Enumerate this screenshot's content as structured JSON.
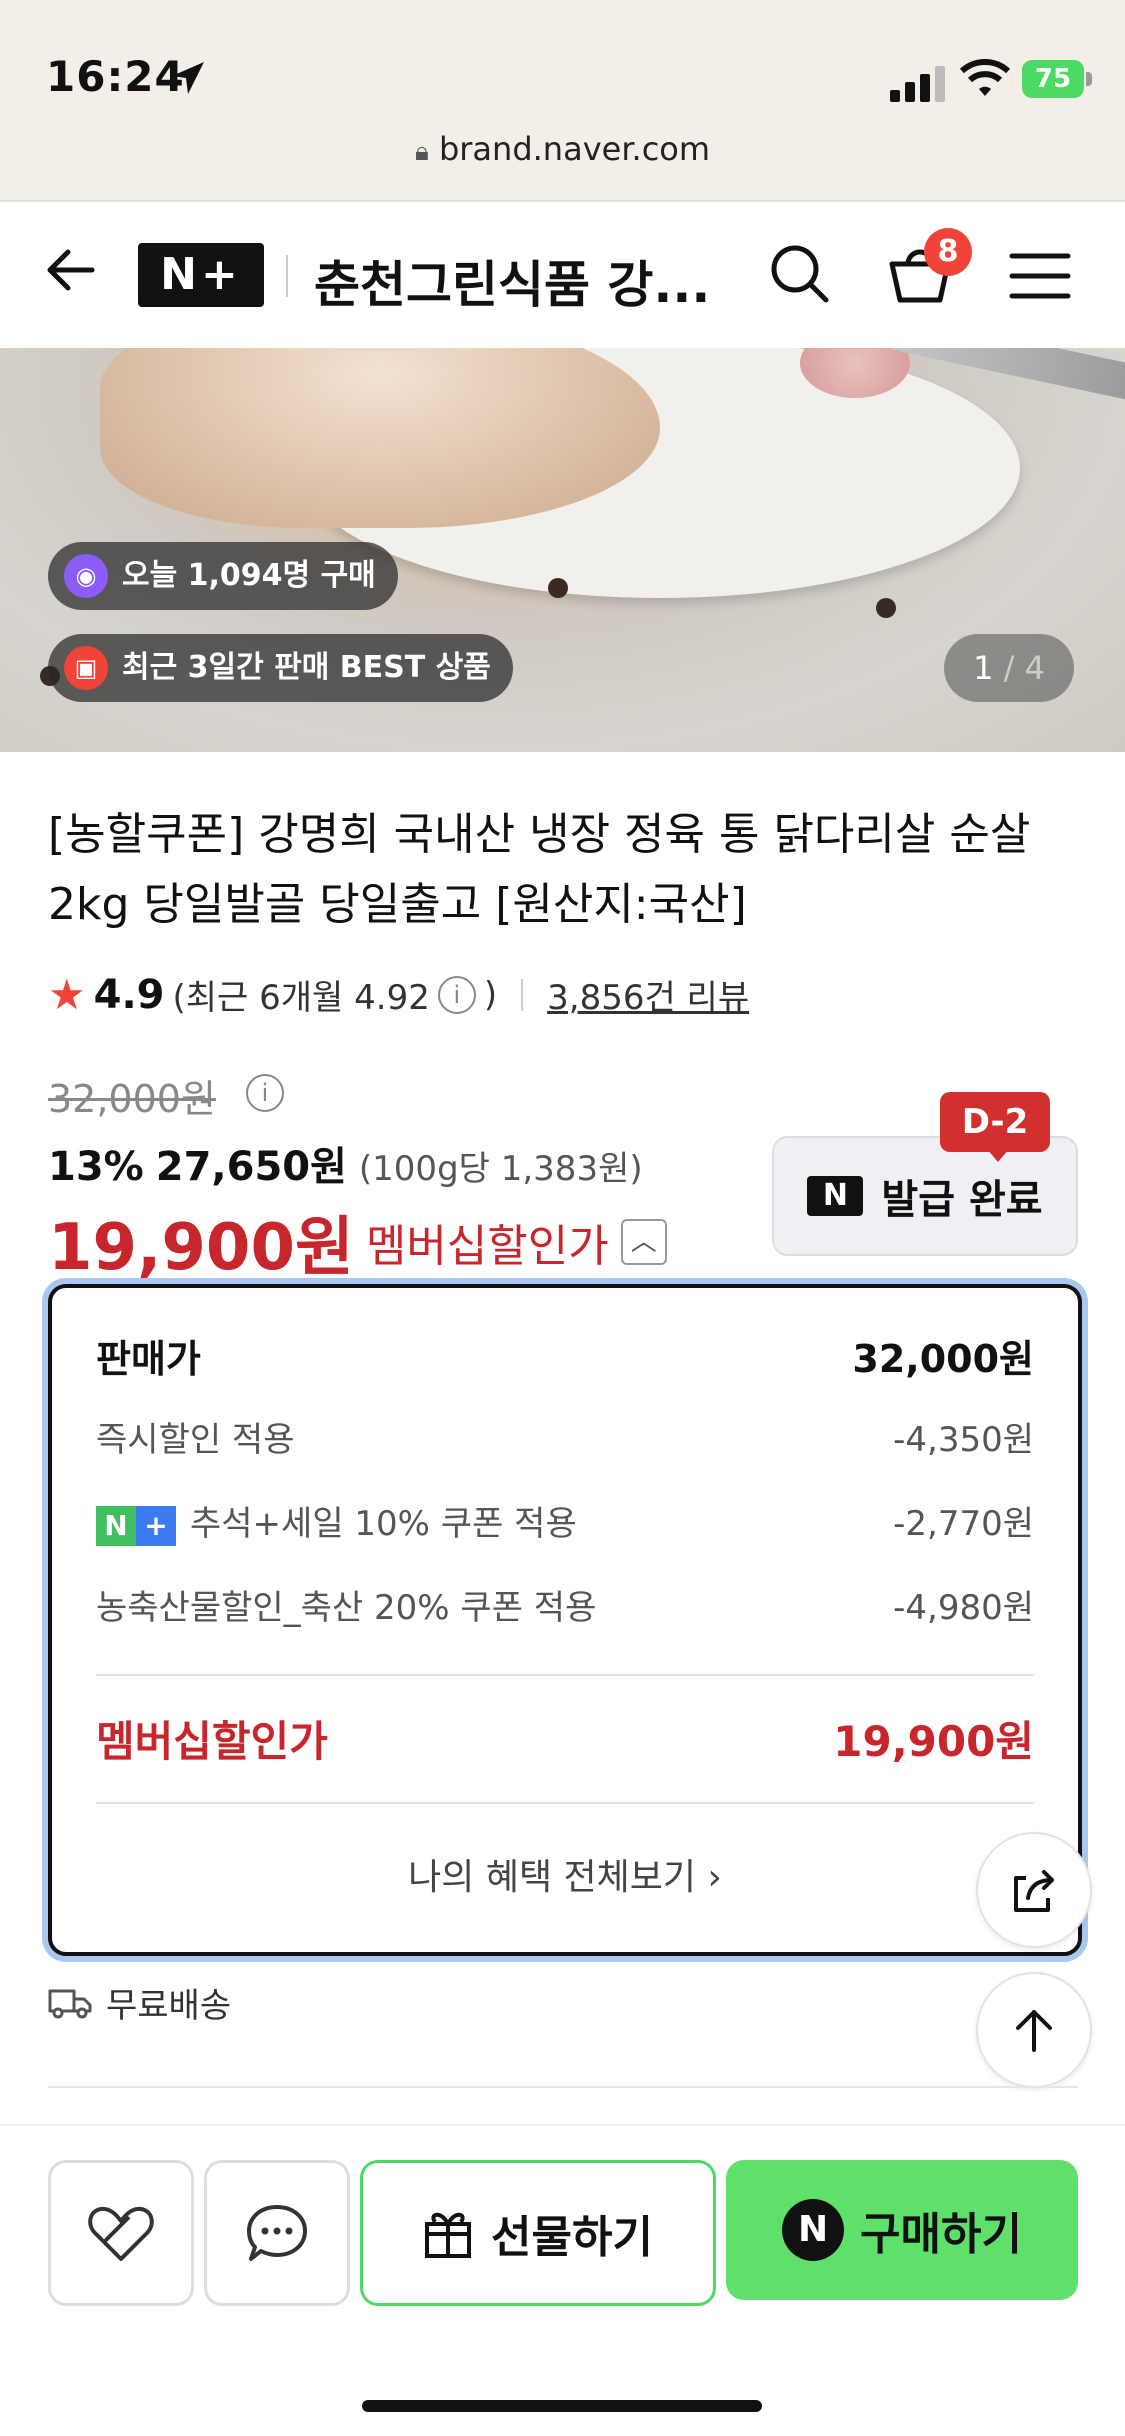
{
  "status": {
    "time": "16:24",
    "battery": "75"
  },
  "browser": {
    "url": "brand.naver.com"
  },
  "header": {
    "brand_logo": "N+",
    "store_name": "춘천그린식품 강...",
    "cart_count": "8"
  },
  "hero": {
    "badges": [
      {
        "text": "오늘 1,094명 구매",
        "icon": "shopping-bag-icon",
        "color": "#8b5cf6"
      },
      {
        "text": "최근 3일간 판매 BEST 상품",
        "icon": "gift-icon",
        "color": "#f04438"
      }
    ],
    "counter_current": "1",
    "counter_total": "4"
  },
  "product": {
    "title": "[농할쿠폰] 강명희 국내산 냉장 정육 통 닭다리살 순살 2kg 당일발골 당일출고 [원산지:국산]",
    "rating": "4.9",
    "rating_recent": "(최근 6개월 4.92",
    "rating_recent_close": ")",
    "review_count": "3,856건 리뷰",
    "original_price": "32,000원",
    "discount_rate": "13%",
    "sale_price": "27,650원",
    "unit_price": "(100g당 1,383원)",
    "member_price": "19,900원",
    "member_label": "멤버십할인가"
  },
  "coupon": {
    "label": "발급 완료",
    "d_day": "D-2",
    "logo": "N"
  },
  "breakdown": {
    "rows": [
      {
        "label": "판매가",
        "value": "32,000원"
      },
      {
        "label": "즉시할인 적용",
        "value": "-4,350원"
      },
      {
        "label": "추석+세일 10% 쿠폰 적용",
        "value": "-2,770원"
      },
      {
        "label": "농축산물할인_축산 20% 쿠폰 적용",
        "value": "-4,980원"
      }
    ],
    "member_label": "멤버십할인가",
    "member_value": "19,900원",
    "footer": "나의 혜택 전체보기",
    "chip_n": "N",
    "chip_plus": "+"
  },
  "shipping": {
    "label": "무료배송"
  },
  "bottom_bar": {
    "gift_label": "선물하기",
    "buy_label": "구매하기",
    "buy_n": "N"
  },
  "colors": {
    "accent_red": "#c8262d",
    "naver_green": "#5fe06a",
    "badge_red": "#d2302e"
  }
}
